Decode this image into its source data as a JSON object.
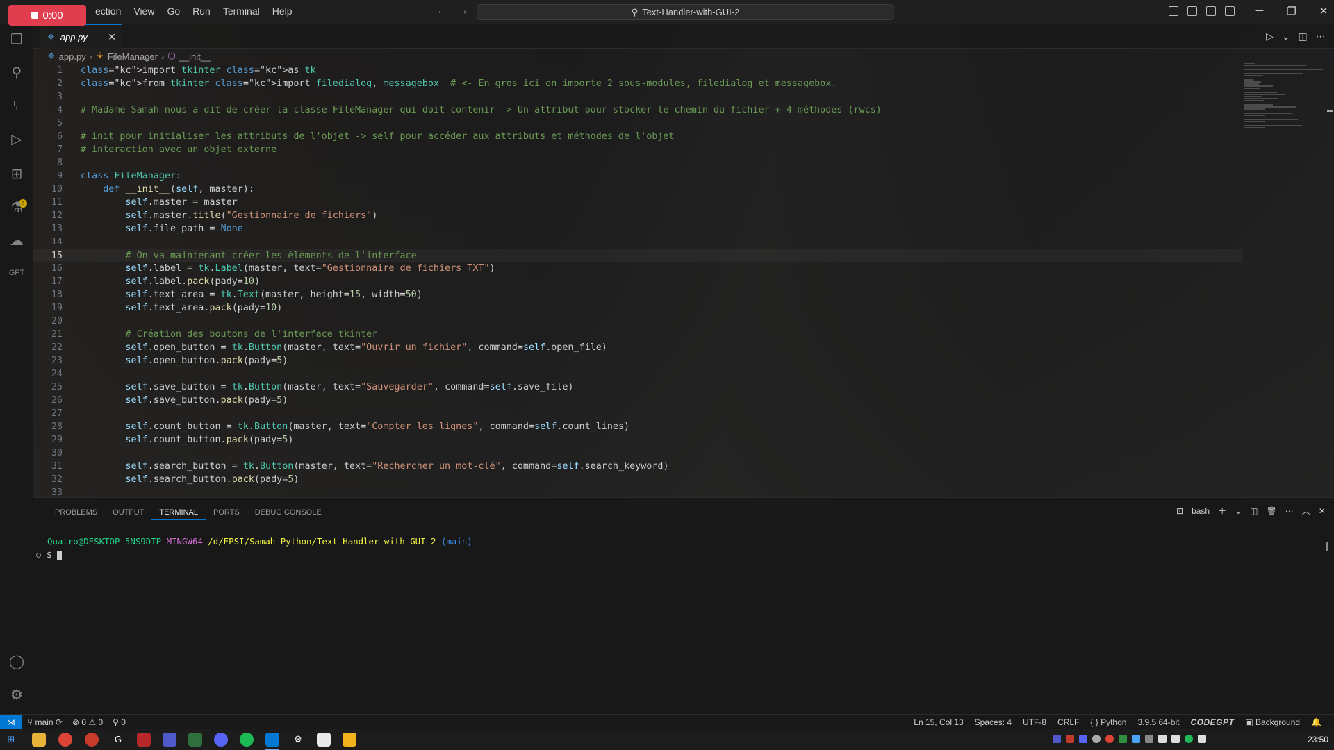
{
  "recorder": {
    "time": "0:00"
  },
  "menu": [
    "ection",
    "View",
    "Go",
    "Run",
    "Terminal",
    "Help"
  ],
  "command_center": {
    "text": "Text-Handler-with-GUI-2"
  },
  "tab": {
    "label": "app.py"
  },
  "breadcrumb": {
    "file": "app.py",
    "class": "FileManager",
    "method": "__init__"
  },
  "code": {
    "current_line": 15,
    "lines": [
      {
        "n": "1",
        "t": "import tkinter as tk"
      },
      {
        "n": "2",
        "t": "from tkinter import filedialog, messagebox  # <- En gros ici on importe 2 sous-modules, filedialog et messagebox."
      },
      {
        "n": "3",
        "t": ""
      },
      {
        "n": "4",
        "t": "# Madame Samah nous a dit de créer la classe FileManager qui doit contenir -> Un attribut pour stocker le chemin du fichier + 4 méthodes (rwcs)"
      },
      {
        "n": "5",
        "t": ""
      },
      {
        "n": "6",
        "t": "# init pour initialiser les attributs de l'objet -> self pour accéder aux attributs et méthodes de l'objet"
      },
      {
        "n": "7",
        "t": "# interaction avec un objet externe"
      },
      {
        "n": "8",
        "t": ""
      },
      {
        "n": "9",
        "t": "class FileManager:"
      },
      {
        "n": "10",
        "t": "    def __init__(self, master):"
      },
      {
        "n": "11",
        "t": "        self.master = master"
      },
      {
        "n": "12",
        "t": "        self.master.title(\"Gestionnaire de fichiers\")"
      },
      {
        "n": "13",
        "t": "        self.file_path = None"
      },
      {
        "n": "14",
        "t": ""
      },
      {
        "n": "15",
        "t": "        # On va maintenant créer les éléments de l'interface"
      },
      {
        "n": "16",
        "t": "        self.label = tk.Label(master, text=\"Gestionnaire de fichiers TXT\")"
      },
      {
        "n": "17",
        "t": "        self.label.pack(pady=10)"
      },
      {
        "n": "18",
        "t": "        self.text_area = tk.Text(master, height=15, width=50)"
      },
      {
        "n": "19",
        "t": "        self.text_area.pack(pady=10)"
      },
      {
        "n": "20",
        "t": ""
      },
      {
        "n": "21",
        "t": "        # Création des boutons de l'interface tkinter"
      },
      {
        "n": "22",
        "t": "        self.open_button = tk.Button(master, text=\"Ouvrir un fichier\", command=self.open_file)"
      },
      {
        "n": "23",
        "t": "        self.open_button.pack(pady=5)"
      },
      {
        "n": "24",
        "t": ""
      },
      {
        "n": "25",
        "t": "        self.save_button = tk.Button(master, text=\"Sauvegarder\", command=self.save_file)"
      },
      {
        "n": "26",
        "t": "        self.save_button.pack(pady=5)"
      },
      {
        "n": "27",
        "t": ""
      },
      {
        "n": "28",
        "t": "        self.count_button = tk.Button(master, text=\"Compter les lignes\", command=self.count_lines)"
      },
      {
        "n": "29",
        "t": "        self.count_button.pack(pady=5)"
      },
      {
        "n": "30",
        "t": ""
      },
      {
        "n": "31",
        "t": "        self.search_button = tk.Button(master, text=\"Rechercher un mot-clé\", command=self.search_keyword)"
      },
      {
        "n": "32",
        "t": "        self.search_button.pack(pady=5)"
      },
      {
        "n": "33",
        "t": ""
      }
    ]
  },
  "panel": {
    "tabs": [
      "PROBLEMS",
      "OUTPUT",
      "TERMINAL",
      "PORTS",
      "DEBUG CONSOLE"
    ],
    "active_tab": "TERMINAL",
    "shell": "bash"
  },
  "terminal": {
    "user": "Quatro@DESKTOP-5NS9DTP",
    "env": "MINGW64",
    "path": "/d/EPSI/Samah Python/Text-Handler-with-GUI-2",
    "branch": "(main)",
    "prompt": "$"
  },
  "status": {
    "branch": "main",
    "errors": "0",
    "warnings": "0",
    "ports": "0",
    "position": "Ln 15, Col 13",
    "spaces": "Spaces: 4",
    "encoding": "UTF-8",
    "eol": "CRLF",
    "language": "Python",
    "interpreter": "3.9.5 64-bit",
    "codegpt": "CODEGPT",
    "background": "Background"
  },
  "taskbar": {
    "clock": "23:50"
  },
  "colors": {
    "accent": "#0078d4",
    "record": "#e03e4e"
  }
}
